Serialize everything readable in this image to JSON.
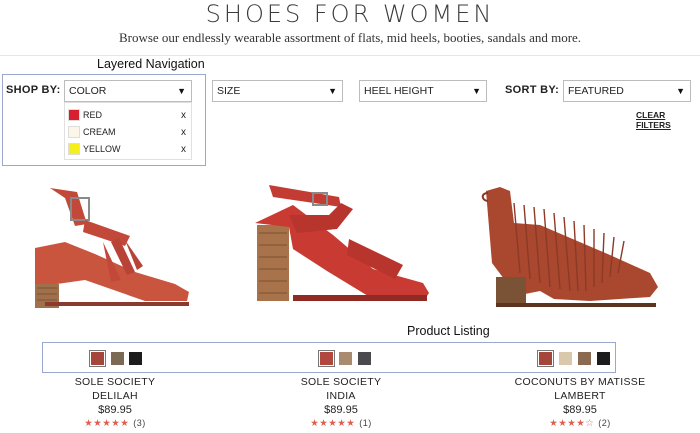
{
  "header": {
    "title": "SHOES FOR WOMEN",
    "subtitle": "Browse our endlessly wearable assortment of flats, mid heels, booties, sandals and more."
  },
  "annotations": {
    "layered_navigation": "Layered Navigation",
    "product_listing": "Product Listing"
  },
  "filters": {
    "shop_by_label": "SHOP BY:",
    "color_select": "COLOR",
    "size_select": "SIZE",
    "heel_select": "HEEL HEIGHT",
    "sort_label": "SORT BY:",
    "sort_select": "FEATURED",
    "clear_filters": "CLEAR FILTERS",
    "arrow": "▼",
    "color_options": [
      {
        "label": "RED",
        "color": "#d81f2f",
        "remove": "x"
      },
      {
        "label": "CREAM",
        "color": "#fbf6e8",
        "remove": "x"
      },
      {
        "label": "YELLOW",
        "color": "#f7ef1c",
        "remove": "x"
      }
    ]
  },
  "products": [
    {
      "brand": "SOLE SOCIETY",
      "name": "DELILAH",
      "price": "$89.95",
      "stars": "★★★★★",
      "rating_value": 5,
      "review_count": "(3)",
      "swatches": [
        "#a4463a",
        "#7a6a55",
        "#1c1c1c"
      ]
    },
    {
      "brand": "SOLE SOCIETY",
      "name": "INDIA",
      "price": "$89.95",
      "stars": "★★★★★",
      "rating_value": 5,
      "review_count": "(1)",
      "swatches": [
        "#b04840",
        "#a98c70",
        "#4a4a4f"
      ]
    },
    {
      "brand": "COCONUTS BY MATISSE",
      "name": "LAMBERT",
      "price": "$89.95",
      "stars": "★★★★☆",
      "rating_value": 4,
      "review_count": "(2)",
      "swatches": [
        "#a4463a",
        "#d8c9ac",
        "#8b6a52",
        "#1c1c1c"
      ]
    }
  ]
}
